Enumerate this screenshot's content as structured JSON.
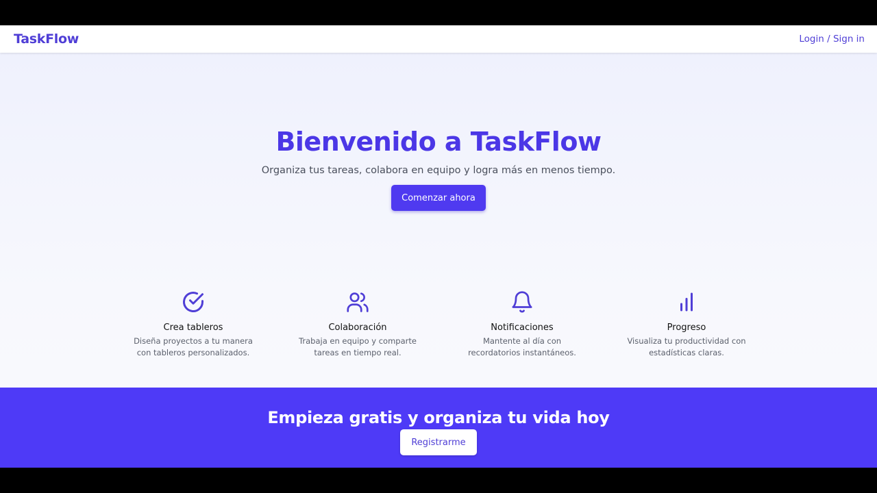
{
  "header": {
    "logo": "TaskFlow",
    "login_label": "Login / Sign in"
  },
  "hero": {
    "title": "Bienvenido a TaskFlow",
    "subtitle": "Organiza tus tareas, colabora en equipo y logra más en menos tiempo.",
    "cta_label": "Comenzar ahora"
  },
  "features": [
    {
      "icon": "check-circle-icon",
      "title": "Crea tableros",
      "description": "Diseña proyectos a tu manera con tableros personalizados."
    },
    {
      "icon": "users-icon",
      "title": "Colaboración",
      "description": "Trabaja en equipo y comparte tareas en tiempo real."
    },
    {
      "icon": "bell-icon",
      "title": "Notificaciones",
      "description": "Mantente al día con recordatorios instantáneos."
    },
    {
      "icon": "bar-chart-icon",
      "title": "Progreso",
      "description": "Visualiza tu productividad con estadísticas claras."
    }
  ],
  "banner": {
    "title": "Empieza gratis y organiza tu vida hoy",
    "register_label": "Registrarme"
  },
  "colors": {
    "accent": "#4f3af0",
    "banner": "#4e3af7",
    "logo": "#4f3ed6"
  }
}
